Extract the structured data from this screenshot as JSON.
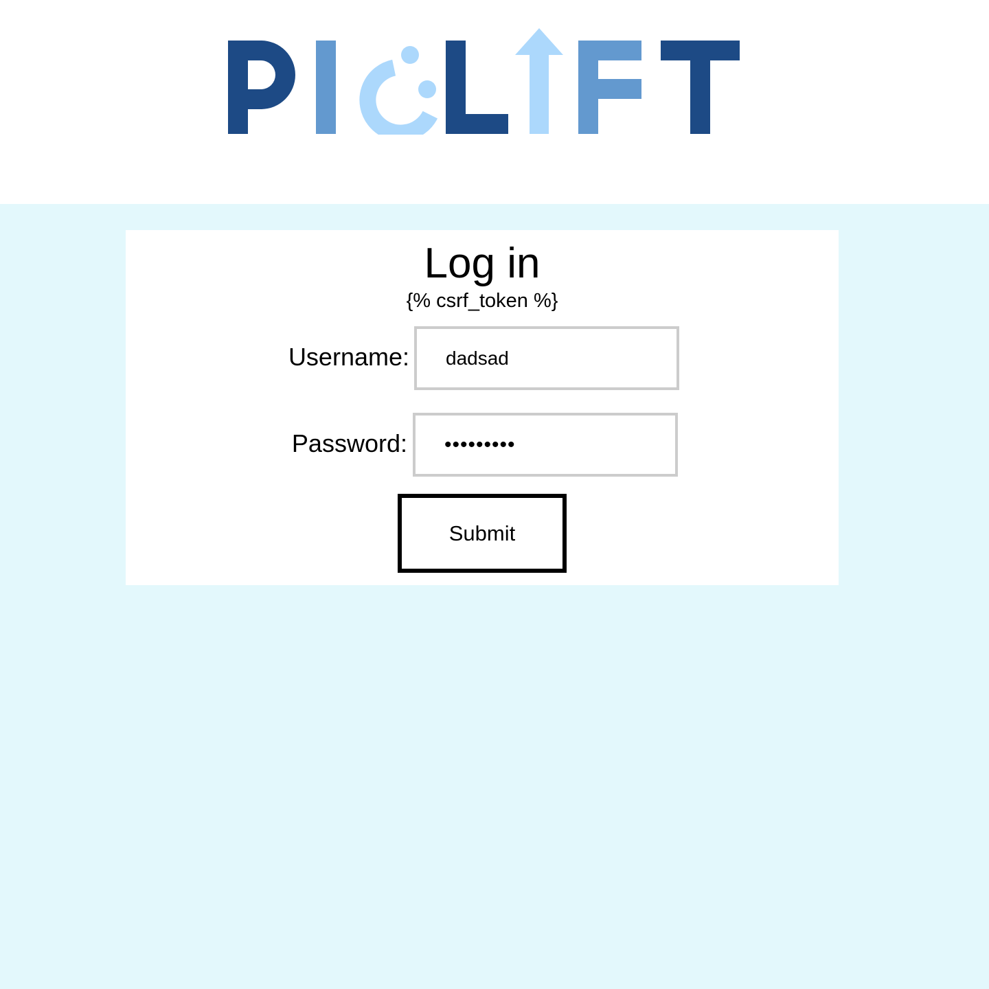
{
  "logo": {
    "text": "PICLIFT"
  },
  "colors": {
    "logo_dark": "#1d4a85",
    "logo_mid": "#6399cf",
    "logo_light": "#acd8fc",
    "page_background": "#e3f8fc",
    "card_background": "#ffffff",
    "input_border": "#cccccc",
    "button_border": "#000000"
  },
  "form": {
    "title": "Log in",
    "csrf_text": "{% csrf_token %}",
    "username_label": "Username:",
    "username_value": "dadsad",
    "password_label": "Password:",
    "password_value": "•••••••••",
    "submit_label": "Submit"
  }
}
